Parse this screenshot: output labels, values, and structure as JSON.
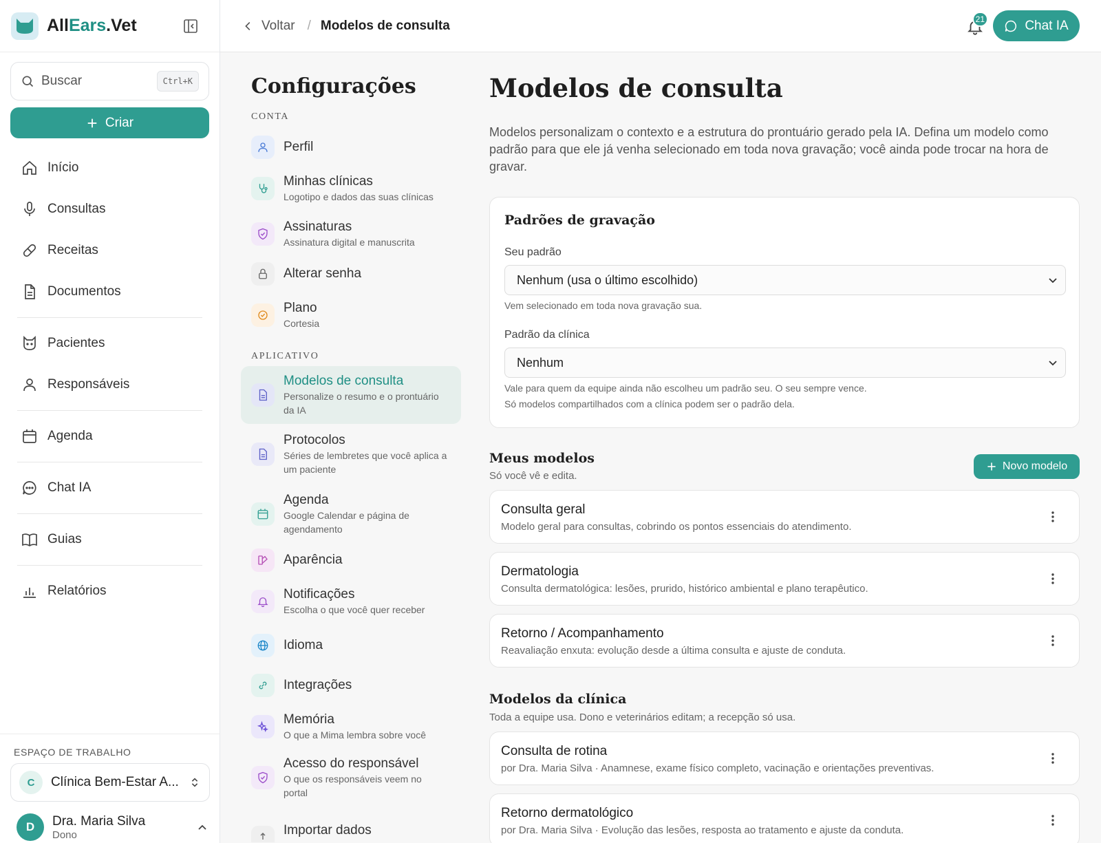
{
  "brand": {
    "name_part1": "All",
    "name_part2": "Ears",
    "name_part3": ".Vet"
  },
  "sidebar": {
    "search_placeholder": "Buscar",
    "search_shortcut": "Ctrl+K",
    "create_label": "Criar",
    "nav": [
      {
        "label": "Início",
        "icon": "home-icon"
      },
      {
        "label": "Consultas",
        "icon": "microphone-icon"
      },
      {
        "label": "Receitas",
        "icon": "pill-icon"
      },
      {
        "label": "Documentos",
        "icon": "document-icon"
      },
      {
        "label": "Pacientes",
        "icon": "cat-icon"
      },
      {
        "label": "Responsáveis",
        "icon": "user-icon"
      },
      {
        "label": "Agenda",
        "icon": "calendar-icon"
      },
      {
        "label": "Chat IA",
        "icon": "chat-icon"
      },
      {
        "label": "Guias",
        "icon": "book-icon"
      },
      {
        "label": "Relatórios",
        "icon": "bar-chart-icon"
      }
    ],
    "workspace_label": "ESPAÇO DE TRABALHO",
    "workspace_initial": "C",
    "workspace_name": "Clínica Bem-Estar A...",
    "user_initial": "D",
    "user_name": "Dra. Maria Silva",
    "user_role": "Dono"
  },
  "topbar": {
    "back_label": "Voltar",
    "separator": "/",
    "current": "Modelos de consulta",
    "notifications_count": "21",
    "chat_label": "Chat IA"
  },
  "settings": {
    "title": "Configurações",
    "section_account": "CONTA",
    "section_app": "APLICATIVO",
    "account_items": [
      {
        "title": "Perfil",
        "subtitle": "",
        "icon": "user-icon"
      },
      {
        "title": "Minhas clínicas",
        "subtitle": "Logotipo e dados das suas clínicas",
        "icon": "stethoscope-icon"
      },
      {
        "title": "Assinaturas",
        "subtitle": "Assinatura digital e manuscrita",
        "icon": "shield-icon"
      },
      {
        "title": "Alterar senha",
        "subtitle": "",
        "icon": "lock-icon"
      },
      {
        "title": "Plano",
        "subtitle": "Cortesia",
        "icon": "badge-check-icon"
      }
    ],
    "app_items": [
      {
        "title": "Modelos de consulta",
        "subtitle": "Personalize o resumo e o prontuário da IA",
        "icon": "document-icon"
      },
      {
        "title": "Protocolos",
        "subtitle": "Séries de lembretes que você aplica a um paciente",
        "icon": "document-icon"
      },
      {
        "title": "Agenda",
        "subtitle": "Google Calendar e página de agendamento",
        "icon": "calendar-icon"
      },
      {
        "title": "Aparência",
        "subtitle": "",
        "icon": "palette-icon"
      },
      {
        "title": "Notificações",
        "subtitle": "Escolha o que você quer receber",
        "icon": "bell-icon"
      },
      {
        "title": "Idioma",
        "subtitle": "",
        "icon": "globe-icon"
      },
      {
        "title": "Integrações",
        "subtitle": "",
        "icon": "link-icon"
      },
      {
        "title": "Memória",
        "subtitle": "O que a Mima lembra sobre você",
        "icon": "sparkles-icon"
      },
      {
        "title": "Acesso do responsável",
        "subtitle": "O que os responsáveis veem no portal",
        "icon": "shield-icon"
      },
      {
        "title": "Importar dados",
        "subtitle": "",
        "icon": "upload-icon"
      }
    ]
  },
  "content": {
    "title": "Modelos de consulta",
    "intro": "Modelos personalizam o contexto e a estrutura do prontuário gerado pela IA. Defina um modelo como padrão para que ele já venha selecionado em toda nova gravação; você ainda pode trocar na hora de gravar.",
    "defaults": {
      "title": "Padrões de gravação",
      "my_label": "Seu padrão",
      "my_value": "Nenhum (usa o último escolhido)",
      "my_help": "Vem selecionado em toda nova gravação sua.",
      "clinic_label": "Padrão da clínica",
      "clinic_value": "Nenhum",
      "clinic_help1": "Vale para quem da equipe ainda não escolheu um padrão seu. O seu sempre vence.",
      "clinic_help2": "Só modelos compartilhados com a clínica podem ser o padrão dela."
    },
    "my_models": {
      "title": "Meus modelos",
      "subtitle": "Só você vê e edita.",
      "new_label": "Novo modelo",
      "items": [
        {
          "name": "Consulta geral",
          "desc": "Modelo geral para consultas, cobrindo os pontos essenciais do atendimento."
        },
        {
          "name": "Dermatologia",
          "desc": "Consulta dermatológica: lesões, prurido, histórico ambiental e plano terapêutico."
        },
        {
          "name": "Retorno / Acompanhamento",
          "desc": "Reavaliação enxuta: evolução desde a última consulta e ajuste de conduta."
        }
      ]
    },
    "clinic_models": {
      "title": "Modelos da clínica",
      "subtitle": "Toda a equipe usa. Dono e veterinários editam; a recepção só usa.",
      "items": [
        {
          "name": "Consulta de rotina",
          "desc": "por Dra. Maria Silva · Anamnese, exame físico completo, vacinação e orientações preventivas."
        },
        {
          "name": "Retorno dermatológico",
          "desc": "por Dra. Maria Silva · Evolução das lesões, resposta ao tratamento e ajuste da conduta."
        }
      ]
    }
  },
  "colors": {
    "accent": "#2f9d91",
    "accent_text": "#1f8f84",
    "active_bg": "#e6efec",
    "page_bg": "#f7f7f7"
  }
}
